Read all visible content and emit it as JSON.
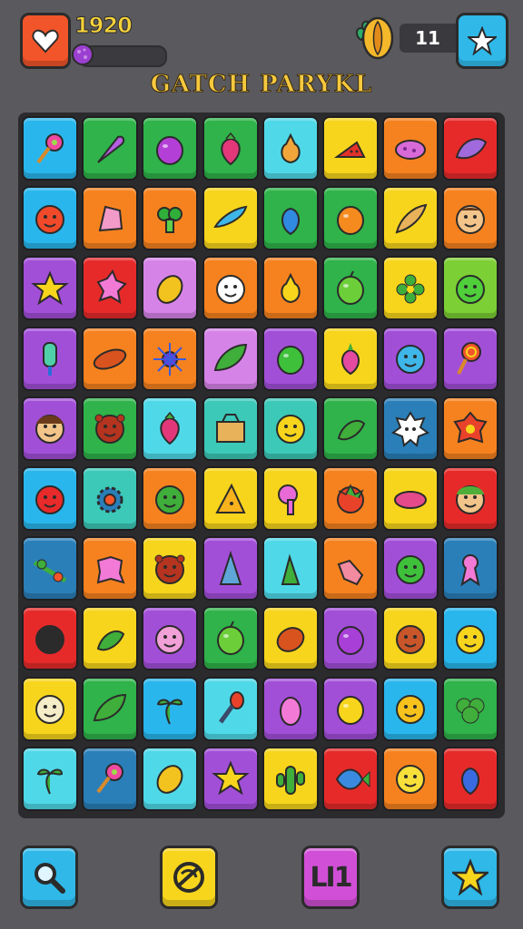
{
  "header": {
    "score": "1920",
    "progress_fraction": 0.08,
    "counter": "11",
    "title": "GATCH PARYKL",
    "colors": {
      "score": "#f6d23a",
      "title": "#f6c93e",
      "heart_button": "#f2552a",
      "star_button": "#2fb8e8",
      "progress": "#8e3bbd"
    }
  },
  "palette": {
    "blue": "#29b6ec",
    "green": "#2fb34a",
    "orange": "#f6821f",
    "red": "#e62a2a",
    "yellow": "#f7d51c",
    "purple": "#a24fd8",
    "cyan": "#4fd9e8",
    "lime": "#7ccf34",
    "teal": "#3cc9b8",
    "navy": "#2a7fb8",
    "pink": "#d683e8"
  },
  "board": {
    "rows": [
      [
        [
          "blue",
          "lollipop-icon"
        ],
        [
          "green",
          "carrot-icon"
        ],
        [
          "green",
          "grape-icon"
        ],
        [
          "green",
          "strawberry-icon"
        ],
        [
          "cyan",
          "pear-icon"
        ],
        [
          "yellow",
          "watermelon-slice-icon"
        ],
        [
          "orange",
          "peanut-icon"
        ],
        [
          "red",
          "eggplant-icon"
        ]
      ],
      [
        [
          "blue",
          "devil-face-icon"
        ],
        [
          "orange",
          "shell-icon"
        ],
        [
          "orange",
          "broccoli-icon"
        ],
        [
          "yellow",
          "leaf-boat-icon"
        ],
        [
          "green",
          "berry-icon"
        ],
        [
          "green",
          "orange-fruit-icon"
        ],
        [
          "yellow",
          "feather-icon"
        ],
        [
          "orange",
          "boy-face-icon"
        ]
      ],
      [
        [
          "purple",
          "star-icon"
        ],
        [
          "red",
          "splash-icon"
        ],
        [
          "pink",
          "mango-icon"
        ],
        [
          "orange",
          "ghost-face-icon"
        ],
        [
          "orange",
          "pear-yellow-icon"
        ],
        [
          "green",
          "apple-icon"
        ],
        [
          "yellow",
          "flower-icon"
        ],
        [
          "lime",
          "monster-face-icon"
        ]
      ],
      [
        [
          "purple",
          "popsicle-icon"
        ],
        [
          "orange",
          "sausage-icon"
        ],
        [
          "orange",
          "burst-icon"
        ],
        [
          "pink",
          "leaf-icon"
        ],
        [
          "purple",
          "green-ball-icon"
        ],
        [
          "yellow",
          "radish-icon"
        ],
        [
          "purple",
          "smiley-icon"
        ],
        [
          "purple",
          "candy-swirl-icon"
        ]
      ],
      [
        [
          "purple",
          "kid-face-icon"
        ],
        [
          "green",
          "bear-face-icon"
        ],
        [
          "cyan",
          "strawberry-icon"
        ],
        [
          "teal",
          "basket-icon"
        ],
        [
          "teal",
          "lemon-face-icon"
        ],
        [
          "green",
          "pepper-icon"
        ],
        [
          "navy",
          "spiky-ghost-icon"
        ],
        [
          "orange",
          "flower-red-icon"
        ]
      ],
      [
        [
          "blue",
          "red-ball-icon"
        ],
        [
          "teal",
          "gear-icon"
        ],
        [
          "orange",
          "cactus-face-icon"
        ],
        [
          "yellow",
          "cheese-icon"
        ],
        [
          "yellow",
          "hairdryer-icon"
        ],
        [
          "orange",
          "tomato-icon"
        ],
        [
          "yellow",
          "bean-icon"
        ],
        [
          "red",
          "girl-face-icon"
        ]
      ],
      [
        [
          "navy",
          "branch-icon"
        ],
        [
          "orange",
          "splash-pink-icon"
        ],
        [
          "yellow",
          "bear-face-icon"
        ],
        [
          "purple",
          "cone-icon"
        ],
        [
          "cyan",
          "pepper-green-icon"
        ],
        [
          "orange",
          "glove-icon"
        ],
        [
          "purple",
          "green-face-icon"
        ],
        [
          "navy",
          "ribbon-icon"
        ]
      ],
      [
        [
          "red",
          "black-face-icon"
        ],
        [
          "yellow",
          "pepper-icon"
        ],
        [
          "purple",
          "pink-face-icon"
        ],
        [
          "green",
          "apple-icon"
        ],
        [
          "yellow",
          "potato-icon"
        ],
        [
          "purple",
          "plum-icon"
        ],
        [
          "yellow",
          "monkey-face-icon"
        ],
        [
          "blue",
          "chick-icon"
        ]
      ],
      [
        [
          "yellow",
          "egg-face-icon"
        ],
        [
          "green",
          "leaf-icon"
        ],
        [
          "blue",
          "sprout-icon"
        ],
        [
          "cyan",
          "microphone-icon"
        ],
        [
          "purple",
          "pink-bean-icon"
        ],
        [
          "purple",
          "lemon-icon"
        ],
        [
          "blue",
          "yellow-face-icon"
        ],
        [
          "green",
          "bush-icon"
        ]
      ],
      [
        [
          "cyan",
          "sprout-icon"
        ],
        [
          "navy",
          "lollipop-icon"
        ],
        [
          "cyan",
          "mango-icon"
        ],
        [
          "purple",
          "star-icon"
        ],
        [
          "yellow",
          "cactus-icon"
        ],
        [
          "red",
          "fish-icon"
        ],
        [
          "orange",
          "cloud-face-icon"
        ],
        [
          "red",
          "blueberry-icon"
        ]
      ]
    ]
  },
  "bottom_bar": {
    "special_label": "LI1",
    "colors": {
      "search": "#2fb8e8",
      "swap": "#f7d51c",
      "special": "#d14fd6",
      "star": "#2fb8e8"
    }
  }
}
